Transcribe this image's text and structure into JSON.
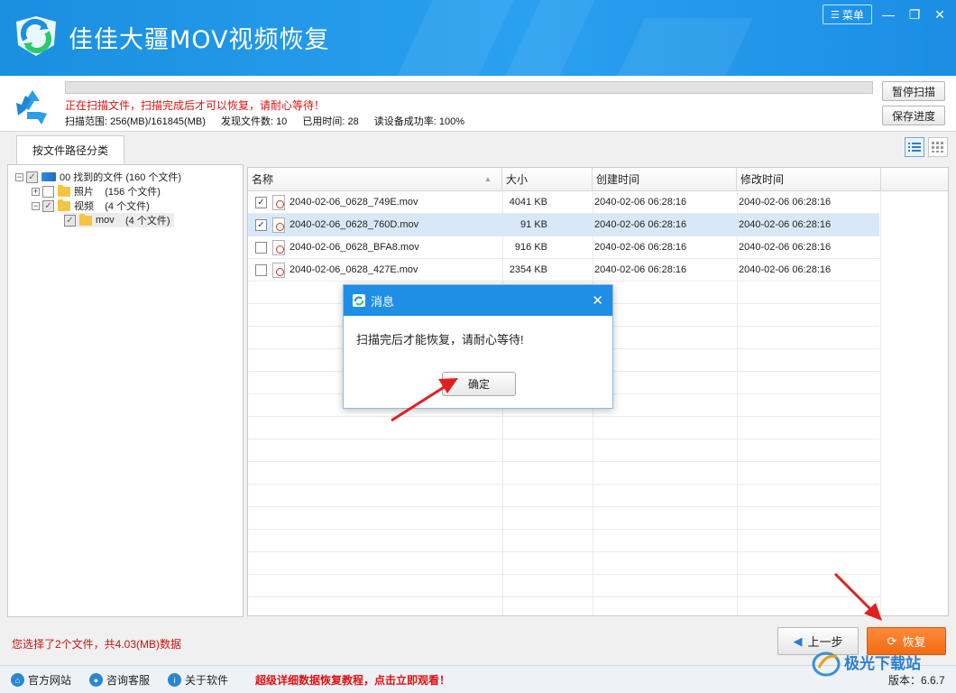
{
  "window": {
    "title": "佳佳大疆MOV视频恢复",
    "menu_label": "菜单",
    "minimize_icon": "minimize-icon",
    "maximize_icon": "maximize-icon",
    "close_icon": "close-icon",
    "brand_color": "#1a8fe0"
  },
  "scan": {
    "progress_percent": 0,
    "message": "正在扫描文件，扫描完成后才可以恢复，请耐心等待！",
    "range": "扫描范围: 256(MB)/161845(MB)",
    "found": "发现文件数: 10",
    "elapsed": "已用时间: 28",
    "read_rate": "读设备成功率: 100%",
    "pause_button": "暂停扫描",
    "save_button": "保存进度"
  },
  "tabs": [
    {
      "label": "按文件路径分类",
      "selected": true
    }
  ],
  "tree": {
    "root": {
      "label": "00 找到的文件",
      "count": "(160 个文件)"
    },
    "photos": {
      "label": "照片",
      "count": "(156 个文件)"
    },
    "videos": {
      "label": "视频",
      "count": "(4 个文件)"
    },
    "mov": {
      "label": "mov",
      "count": "(4 个文件)"
    }
  },
  "table": {
    "columns": [
      "名称",
      "大小",
      "创建时间",
      "修改时间"
    ],
    "rows": [
      {
        "checked": true,
        "name": "2040-02-06_0628_749E.mov",
        "size": "4041 KB",
        "created": "2040-02-06  06:28:16",
        "modified": "2040-02-06  06:28:16"
      },
      {
        "checked": true,
        "name": "2040-02-06_0628_760D.mov",
        "size": "91 KB",
        "created": "2040-02-06  06:28:16",
        "modified": "2040-02-06  06:28:16"
      },
      {
        "checked": false,
        "name": "2040-02-06_0628_BFA8.mov",
        "size": "916 KB",
        "created": "2040-02-06  06:28:16",
        "modified": "2040-02-06  06:28:16"
      },
      {
        "checked": false,
        "name": "2040-02-06_0628_427E.mov",
        "size": "2354 KB",
        "created": "2040-02-06  06:28:16",
        "modified": "2040-02-06  06:28:16"
      }
    ]
  },
  "footer": {
    "selection_info": "您选择了2个文件，共4.03(MB)数据",
    "prev_button": "上一步",
    "recover_button": "恢复",
    "accent_color": "#f26b12"
  },
  "statusbar": {
    "website": "官方网站",
    "support": "咨询客服",
    "about": "关于软件",
    "promo": "超级详细数据恢复教程，点击立即观看！",
    "version": "版本：6.6.7"
  },
  "dialog": {
    "title": "消息",
    "message": "扫描完后才能恢复，请耐心等待!",
    "ok_button": "确定"
  },
  "watermark": {
    "text": "极光下载站"
  }
}
